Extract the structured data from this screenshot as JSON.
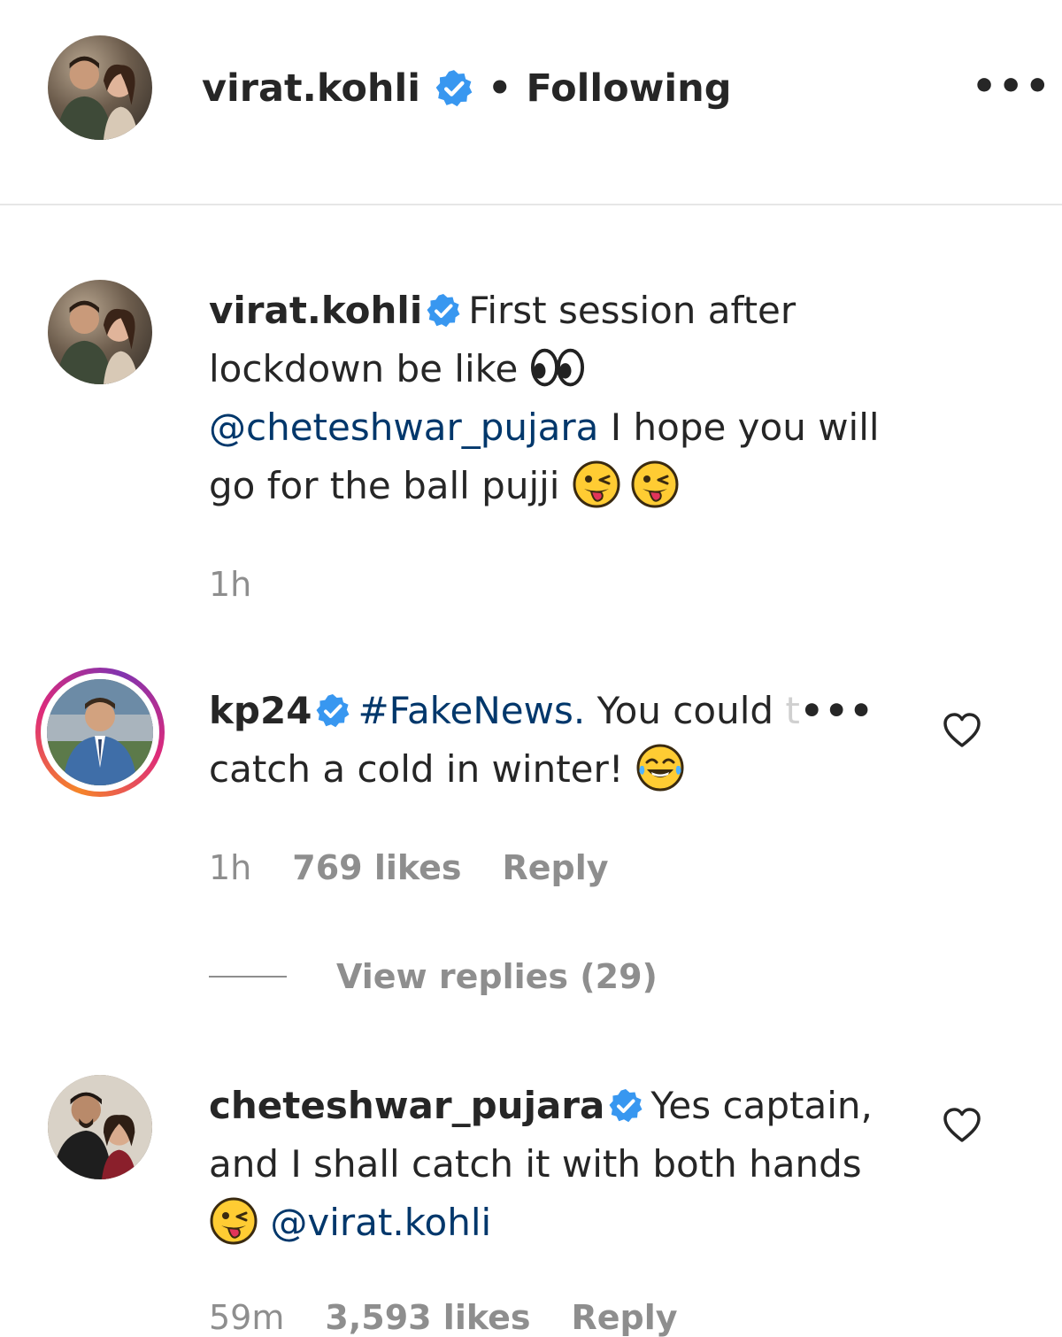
{
  "header": {
    "username": "virat.kohli",
    "separator": "•",
    "follow_status": "Following",
    "more_label": "•••"
  },
  "caption": {
    "username": "virat.kohli",
    "text_1": "First session after lockdown be like",
    "emoji_1": "eyes-emoji",
    "mention": "@cheteshwar_pujara",
    "text_2": "I hope you will go for the ball pujji",
    "emoji_2": "winking-tongue-emoji",
    "time": "1h"
  },
  "comments": [
    {
      "username": "kp24",
      "hashtag": "#FakeNews.",
      "text_visible": "You could",
      "text_faded": "t",
      "more_label": "•••",
      "text_2": "catch a cold in winter!",
      "emoji": "tears-of-joy-emoji",
      "time": "1h",
      "likes": "769 likes",
      "reply_label": "Reply",
      "view_replies": "View replies (29)"
    },
    {
      "username": "cheteshwar_pujara",
      "text_1": "Yes captain, and I shall catch it with both hands",
      "emoji": "winking-tongue-emoji",
      "mention": "@virat.kohli",
      "time": "59m",
      "likes": "3,593 likes",
      "reply_label": "Reply"
    }
  ],
  "colors": {
    "text": "#262626",
    "secondary": "#8e8e8e",
    "link": "#00376b",
    "verified_badge": "#3897f0"
  },
  "icons": [
    "verified-badge-icon",
    "more-options-icon",
    "heart-icon"
  ]
}
